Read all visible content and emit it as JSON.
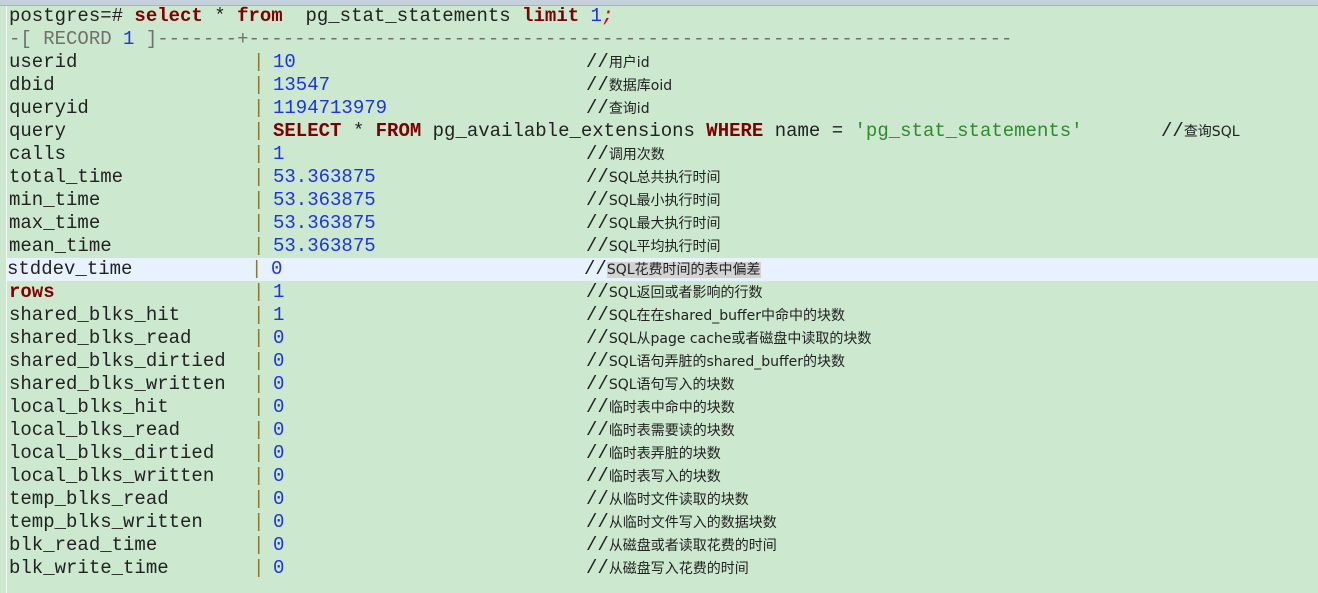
{
  "prompt": {
    "prefix": "postgres=# ",
    "kw_select": "select",
    "star": " * ",
    "kw_from": "from",
    "table": "  pg_stat_statements ",
    "kw_limit": "limit",
    "limit_value": "1",
    "semicolon": ";"
  },
  "record_header": {
    "open": "-[ RECORD ",
    "number": "1",
    "close": " ]",
    "dashes_left": "-------",
    "plus": "+",
    "dashes_right": "-------------------------------------------------------------------"
  },
  "pipe": "|",
  "rows": [
    {
      "name": "userid",
      "value": "10",
      "comment_prefix": "//",
      "comment": "用户id"
    },
    {
      "name": "dbid",
      "value": "13547",
      "comment_prefix": "//",
      "comment": "数据库oid"
    },
    {
      "name": "queryid",
      "value": "1194713979",
      "comment_prefix": "//",
      "comment": "查询id"
    },
    {
      "name": "query",
      "query": {
        "kw_select": "SELECT",
        "star": " * ",
        "kw_from": "FROM",
        "table": " pg_available_extensions ",
        "kw_where": "WHERE",
        "cond": " name = ",
        "literal": "'pg_stat_statements'"
      },
      "comment_prefix": "//",
      "comment": "查询SQL"
    },
    {
      "name": "calls",
      "value": "1",
      "comment_prefix": "//",
      "comment": "调用次数"
    },
    {
      "name": "total_time",
      "value": "53.363875",
      "comment_prefix": "//",
      "comment": "SQL总共执行时间"
    },
    {
      "name": "min_time",
      "value": "53.363875",
      "comment_prefix": "//",
      "comment": "SQL最小执行时间"
    },
    {
      "name": "max_time",
      "value": "53.363875",
      "comment_prefix": "//",
      "comment": "SQL最大执行时间"
    },
    {
      "name": "mean_time",
      "value": "53.363875",
      "comment_prefix": "//",
      "comment": "SQL平均执行时间"
    },
    {
      "name": "stddev_time",
      "value": "0",
      "comment_prefix": "//",
      "comment": "SQL花费时间的表中偏差",
      "highlighted": true
    },
    {
      "name": "rows",
      "value": "1",
      "comment_prefix": "//",
      "comment": "SQL返回或者影响的行数"
    },
    {
      "name": "shared_blks_hit",
      "value": "1",
      "comment_prefix": "//",
      "comment": "SQL在在shared_buffer中命中的块数"
    },
    {
      "name": "shared_blks_read",
      "value": "0",
      "comment_prefix": "//",
      "comment": "SQL从page cache或者磁盘中读取的块数"
    },
    {
      "name": "shared_blks_dirtied",
      "value": "0",
      "comment_prefix": "//",
      "comment": "SQL语句弄脏的shared_buffer的块数"
    },
    {
      "name": "shared_blks_written",
      "value": "0",
      "comment_prefix": "//",
      "comment": "SQL语句写入的块数"
    },
    {
      "name": "local_blks_hit",
      "value": "0",
      "comment_prefix": "//",
      "comment": "临时表中命中的块数"
    },
    {
      "name": "local_blks_read",
      "value": "0",
      "comment_prefix": "//",
      "comment": "临时表需要读的块数"
    },
    {
      "name": "local_blks_dirtied",
      "value": "0",
      "comment_prefix": "//",
      "comment": "临时表弄脏的块数"
    },
    {
      "name": "local_blks_written",
      "value": "0",
      "comment_prefix": "//",
      "comment": "临时表写入的块数"
    },
    {
      "name": "temp_blks_read",
      "value": "0",
      "comment_prefix": "//",
      "comment": "从临时文件读取的块数"
    },
    {
      "name": "temp_blks_written",
      "value": "0",
      "comment_prefix": "//",
      "comment": "从临时文件写入的数据块数"
    },
    {
      "name": "blk_read_time",
      "value": "0",
      "comment_prefix": "//",
      "comment": "从磁盘或者读取花费的时间"
    },
    {
      "name": "blk_write_time",
      "value": "0",
      "comment_prefix": "//",
      "comment": "从磁盘写入花费的时间"
    }
  ],
  "colors": {
    "background": "#cce8cf",
    "keyword": "#7f0000",
    "number": "#1e32e6",
    "string": "#2e8b2e",
    "highlight_row": "#e8f2fe"
  }
}
